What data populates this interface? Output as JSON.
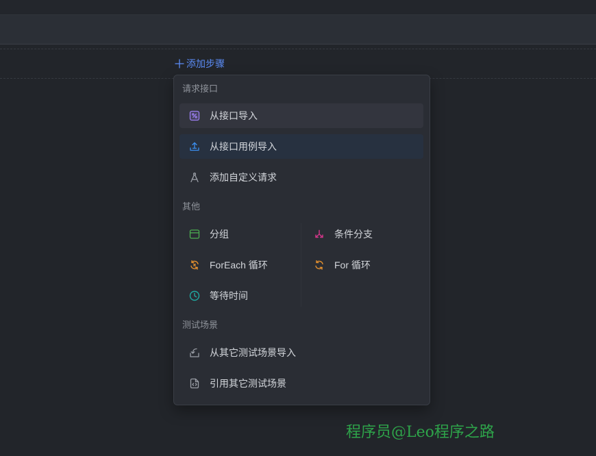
{
  "add_step": {
    "label": "添加步骤",
    "icon": "plus-icon",
    "color": "#5b8cf6"
  },
  "menu": {
    "sections": [
      {
        "title": "请求接口",
        "items": [
          {
            "label": "从接口导入",
            "icon": "api-import-icon",
            "color": "#9b7ef0"
          },
          {
            "label": "从接口用例导入",
            "icon": "case-import-icon",
            "color": "#3b8ff0"
          },
          {
            "label": "添加自定义请求",
            "icon": "custom-request-icon",
            "color": "#9a9ea6"
          }
        ]
      },
      {
        "title": "其他",
        "items": [
          {
            "label": "分组",
            "icon": "group-icon",
            "color": "#4caf50"
          },
          {
            "label": "条件分支",
            "icon": "branch-icon",
            "color": "#d6368c"
          },
          {
            "label": "ForEach 循环",
            "icon": "foreach-loop-icon",
            "color": "#e3902f"
          },
          {
            "label": "For 循环",
            "icon": "for-loop-icon",
            "color": "#e3902f"
          },
          {
            "label": "等待时间",
            "icon": "clock-icon",
            "color": "#1fa8a0"
          }
        ]
      },
      {
        "title": "测试场景",
        "items": [
          {
            "label": "从其它测试场景导入",
            "icon": "scenario-import-icon",
            "color": "#9a9ea6"
          },
          {
            "label": "引用其它测试场景",
            "icon": "scenario-reference-icon",
            "color": "#9a9ea6"
          }
        ]
      }
    ]
  },
  "watermark": {
    "text": "程序员@Leo程序之路",
    "color": "#2ea44a"
  }
}
